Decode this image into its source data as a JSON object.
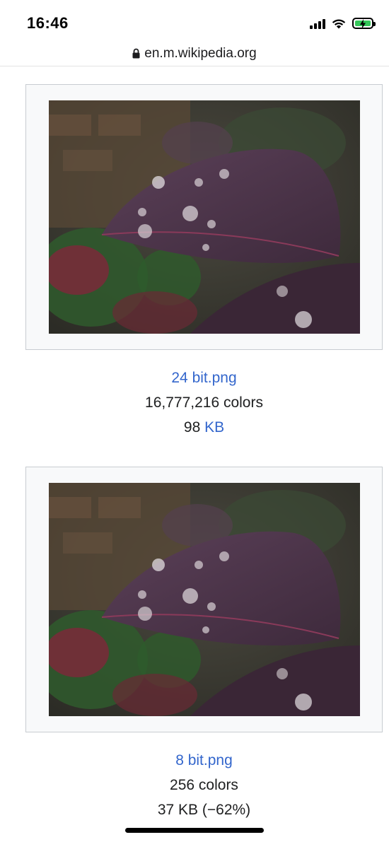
{
  "status_bar": {
    "time": "16:46"
  },
  "browser": {
    "url": "en.m.wikipedia.org"
  },
  "gallery": [
    {
      "file_name": "24 bit.png",
      "colors": "16,777,216 colors",
      "size_value": "98",
      "size_unit": "KB",
      "size_suffix": ""
    },
    {
      "file_name": "8 bit.png",
      "colors": "256 colors",
      "size_value": "37",
      "size_unit": "KB",
      "size_suffix": "(−62%)"
    }
  ],
  "colors": {
    "link": "#3366cc",
    "frame_bg": "#f8f9fa",
    "frame_border": "#c8ccd1",
    "battery_green": "#34c759"
  }
}
